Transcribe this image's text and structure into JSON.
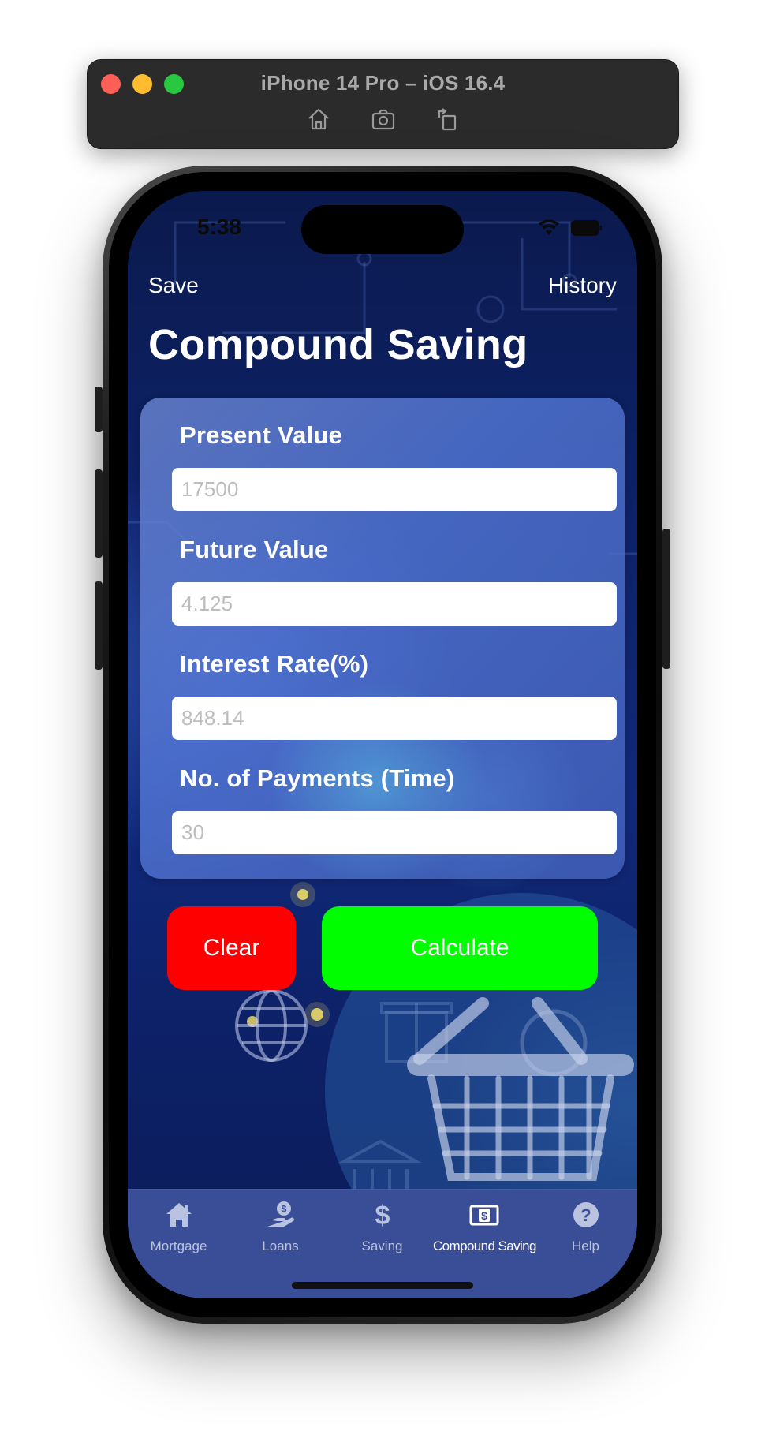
{
  "simulator": {
    "title": "iPhone 14 Pro – iOS 16.4",
    "toolbar_icons": [
      "home-icon",
      "screenshot-icon",
      "rotate-icon"
    ]
  },
  "status_bar": {
    "time": "5:38",
    "icons": [
      "wifi-icon",
      "battery-icon"
    ]
  },
  "nav": {
    "left_label": "Save",
    "right_label": "History",
    "title": "Compound Saving"
  },
  "form": {
    "fields": [
      {
        "label": "Present Value",
        "placeholder": "17500"
      },
      {
        "label": "Future Value",
        "placeholder": "4.125"
      },
      {
        "label": "Interest Rate(%)",
        "placeholder": "848.14"
      },
      {
        "label": "No. of Payments (Time)",
        "placeholder": "30"
      }
    ]
  },
  "buttons": {
    "clear_label": "Clear",
    "calculate_label": "Calculate",
    "clear_color": "#fe0000",
    "calculate_color": "#00fe00"
  },
  "tabbar": {
    "active_index": 3,
    "tabs": [
      {
        "label": "Mortgage",
        "icon": "house-icon"
      },
      {
        "label": "Loans",
        "icon": "hand-dollar-icon"
      },
      {
        "label": "Saving",
        "icon": "dollar-icon"
      },
      {
        "label": "Compound Saving",
        "icon": "dollar-bill-icon"
      },
      {
        "label": "Help",
        "icon": "question-circle-icon"
      }
    ]
  }
}
